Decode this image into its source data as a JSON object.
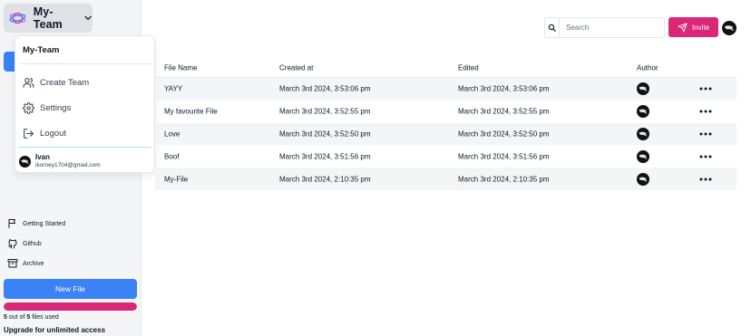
{
  "sidebar": {
    "team_name": "My-Team",
    "links": [
      {
        "label": "Getting Started",
        "icon": "flag-icon"
      },
      {
        "label": "Github",
        "icon": "github-icon"
      },
      {
        "label": "Archive",
        "icon": "archive-icon"
      }
    ],
    "new_file_label": "New File",
    "usage": {
      "used": "5",
      "of_text": "out of",
      "total": "5",
      "suffix_text": "files used",
      "fraction": 1.0
    },
    "upgrade_label": "Upgrade for unlimited access"
  },
  "dropdown": {
    "title": "My-Team",
    "items": [
      {
        "label": "Create Team",
        "icon": "users-icon"
      },
      {
        "label": "Settings",
        "icon": "gear-icon"
      },
      {
        "label": "Logout",
        "icon": "logout-icon"
      }
    ],
    "user": {
      "name": "Ivan",
      "email": "ikorney1704@gmail.com"
    }
  },
  "header": {
    "search_placeholder": "Search",
    "search_value": "",
    "invite_label": "Invite"
  },
  "table": {
    "columns": {
      "name": "File Name",
      "created": "Created at",
      "edited": "Edited",
      "author": "Author"
    },
    "rows": [
      {
        "name": "YAYY",
        "created": "March 3rd 2024, 3:53:06 pm",
        "edited": "March 3rd 2024, 3:53:06 pm"
      },
      {
        "name": "My favourite File",
        "created": "March 3rd 2024, 3:52:55 pm",
        "edited": "March 3rd 2024, 3:52:55 pm"
      },
      {
        "name": "Love",
        "created": "March 3rd 2024, 3:52:50 pm",
        "edited": "March 3rd 2024, 3:52:50 pm"
      },
      {
        "name": "Boof",
        "created": "March 3rd 2024, 3:51:56 pm",
        "edited": "March 3rd 2024, 3:51:56 pm"
      },
      {
        "name": "My-File",
        "created": "March 3rd 2024, 2:10:35 pm",
        "edited": "March 3rd 2024, 2:10:35 pm"
      }
    ]
  },
  "colors": {
    "primary": "#3b82f6",
    "accent": "#db2777",
    "sidebar_bg": "#f4f5f7"
  }
}
